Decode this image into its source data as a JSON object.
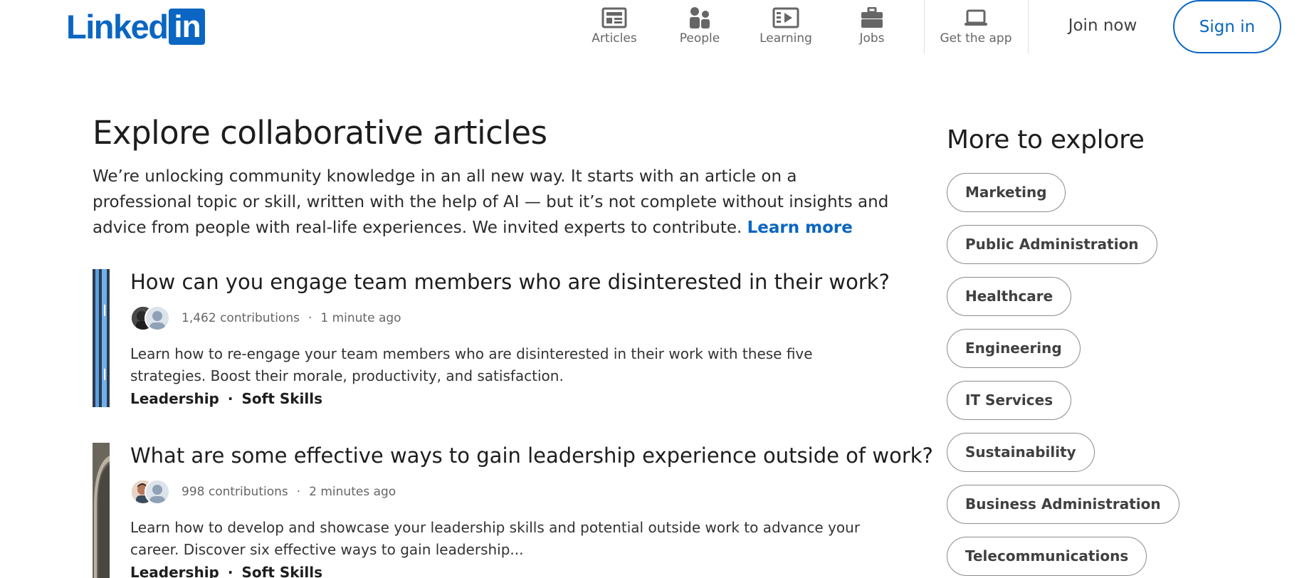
{
  "header": {
    "logo_text": "Linked",
    "logo_box": "in",
    "nav": [
      {
        "label": "Articles",
        "icon": "articles-icon"
      },
      {
        "label": "People",
        "icon": "people-icon"
      },
      {
        "label": "Learning",
        "icon": "learning-icon"
      },
      {
        "label": "Jobs",
        "icon": "jobs-icon"
      },
      {
        "label": "Get the app",
        "icon": "laptop-icon"
      }
    ],
    "join_label": "Join now",
    "signin_label": "Sign in"
  },
  "main": {
    "title": "Explore collaborative articles",
    "intro": "We’re unlocking community knowledge in an all new way. It starts with an article on a professional topic or skill, written with the help of AI — but it’s not complete without insights and advice from people with real-life experiences. We invited experts to contribute.",
    "learn_more": "Learn more",
    "articles": [
      {
        "title": "How can you engage team members who are disinterested in their work?",
        "contributions": "1,462 contributions",
        "time": "1 minute ago",
        "description": "Learn how to re-engage your team members who are disinterested in their work with these five strategies. Boost their morale, productivity, and satisfaction.",
        "tags": [
          "Leadership",
          "Soft Skills"
        ]
      },
      {
        "title": "What are some effective ways to gain leadership experience outside of work?",
        "contributions": "998 contributions",
        "time": "2 minutes ago",
        "description": "Learn how to develop and showcase your leadership skills and potential outside work to advance your career. Discover six effective ways to gain leadership...",
        "tags": [
          "Leadership",
          "Soft Skills"
        ]
      }
    ],
    "meta_separator": "·"
  },
  "sidebar": {
    "title": "More to explore",
    "topics": [
      "Marketing",
      "Public Administration",
      "Healthcare",
      "Engineering",
      "IT Services",
      "Sustainability",
      "Business Administration",
      "Telecommunications"
    ]
  },
  "colors": {
    "brand": "#0a66c2",
    "text": "#1d1d1d",
    "muted": "#666666"
  }
}
